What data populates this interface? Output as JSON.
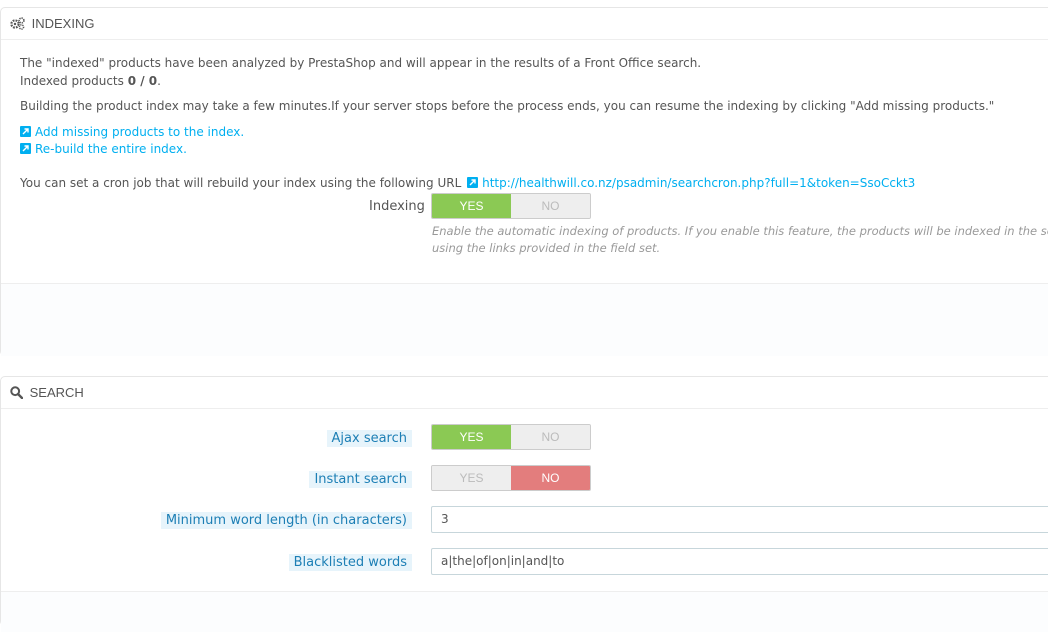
{
  "indexing": {
    "title": "Indexing",
    "intro_line": "The \"indexed\" products have been analyzed by PrestaShop and will appear in the results of a Front Office search.",
    "indexed_label": "Indexed products",
    "indexed_value": "0 / 0",
    "indexed_suffix": ".",
    "build_note": "Building the product index may take a few minutes.If your server stops before the process ends, you can resume the indexing by clicking \"Add missing products.\"",
    "link_add_missing": "Add missing products to the index.",
    "link_rebuild": "Re-build the entire index.",
    "cron_text": "You can set a cron job that will rebuild your index using the following URL",
    "cron_url": "http://healthwill.co.nz/psadmin/searchcron.php?full=1&token=SsoCckt3",
    "toggle_label": "Indexing",
    "toggle_yes": "YES",
    "toggle_no": "NO",
    "toggle_state": "yes",
    "help_line1": "Enable the automatic indexing of products. If you enable this feature, the products will be indexed in the search",
    "help_line2": "using the links provided in the field set."
  },
  "search": {
    "title": "Search",
    "ajax_label": "Ajax search",
    "ajax_yes": "YES",
    "ajax_no": "NO",
    "ajax_state": "yes",
    "instant_label": "Instant search",
    "instant_yes": "YES",
    "instant_no": "NO",
    "instant_state": "no",
    "minlen_label": "Minimum word length (in characters)",
    "minlen_value": "3",
    "blacklist_label": "Blacklisted words",
    "blacklist_value": "a|the|of|on|in|and|to"
  },
  "colors": {
    "yes_active": "#8bc954",
    "no_active": "#e37d7d",
    "link": "#00aff0",
    "label_highlight_bg": "#e7f4fb"
  }
}
